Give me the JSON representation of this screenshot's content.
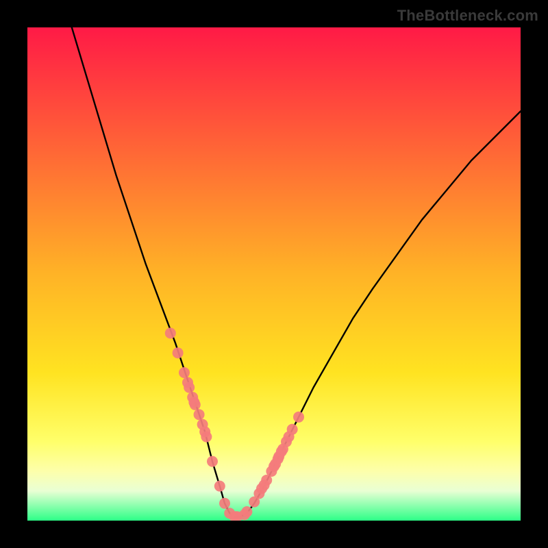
{
  "watermark": "TheBottleneck.com",
  "chart_data": {
    "type": "line",
    "title": "",
    "xlabel": "",
    "ylabel": "",
    "xlim": [
      0,
      100
    ],
    "ylim": [
      0,
      100
    ],
    "grid": false,
    "legend": false,
    "background_gradient": {
      "direction": "vertical",
      "stops": [
        {
          "offset": 0.0,
          "color": "#ff1a46"
        },
        {
          "offset": 0.5,
          "color": "#ffb326"
        },
        {
          "offset": 0.7,
          "color": "#ffe321"
        },
        {
          "offset": 0.84,
          "color": "#ffff6a"
        },
        {
          "offset": 0.9,
          "color": "#fdffab"
        },
        {
          "offset": 0.94,
          "color": "#e9ffd4"
        },
        {
          "offset": 1.0,
          "color": "#2dff87"
        }
      ]
    },
    "series": [
      {
        "name": "bottleneck-curve",
        "type": "line",
        "color": "#000000",
        "x": [
          9,
          12,
          15,
          18,
          21,
          24,
          27,
          30,
          32,
          34,
          36,
          37.5,
          39,
          40,
          41,
          42,
          43,
          44.5,
          46,
          48,
          50,
          52,
          55,
          58,
          62,
          66,
          70,
          75,
          80,
          85,
          90,
          95,
          100
        ],
        "y": [
          100,
          90,
          80,
          70,
          61,
          52,
          44,
          36,
          30,
          24,
          18,
          12,
          7,
          3.5,
          1.5,
          0.7,
          0.7,
          1.5,
          3.5,
          7,
          11,
          15,
          21,
          27,
          34,
          41,
          47,
          54,
          61,
          67,
          73,
          78,
          83
        ]
      },
      {
        "name": "highlighted-points",
        "type": "scatter",
        "color": "#f47c7c",
        "marker_radius": 8,
        "x": [
          29,
          30.5,
          31.8,
          32.5,
          32.8,
          33.5,
          33.8,
          34.0,
          34.8,
          35.5,
          36.0,
          36.3,
          37.5,
          39.0,
          40.0,
          41.0,
          42.0,
          42.5,
          44.0,
          44.5,
          46.0,
          47.0,
          47.5,
          48.0,
          48.5,
          49.5,
          50.0,
          50.3,
          50.8,
          51.0,
          51.5,
          51.8,
          52.5,
          53.0,
          53.7,
          55.0
        ],
        "y": [
          38,
          34,
          30,
          28,
          27,
          25,
          24,
          23.5,
          21.5,
          19.5,
          18,
          17,
          12,
          7,
          3.5,
          1.5,
          0.8,
          0.8,
          1.2,
          1.8,
          3.8,
          5.5,
          6.5,
          7.2,
          8.2,
          10,
          11,
          11.5,
          12.5,
          13,
          14,
          14.5,
          16,
          17,
          18.5,
          21
        ]
      }
    ]
  }
}
